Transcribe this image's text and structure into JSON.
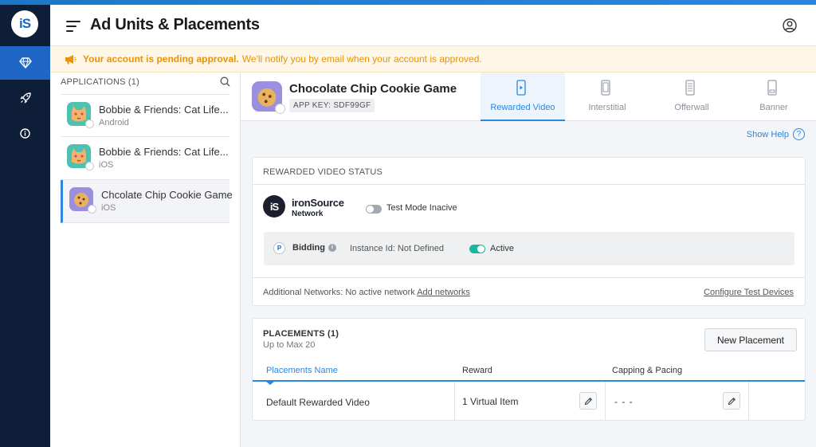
{
  "header": {
    "title": "Ad Units & Placements"
  },
  "sidebar": {
    "logo_text": "iS",
    "items": [
      {
        "name": "diamond-icon",
        "active": true
      },
      {
        "name": "rocket-icon",
        "active": false
      },
      {
        "name": "info-icon",
        "active": false
      }
    ]
  },
  "banner": {
    "strong_text": "Your account is pending approval.",
    "normal_text": "We'll notify you by email when your account is approved."
  },
  "apps": {
    "header": "APPLICATIONS (1)",
    "items": [
      {
        "name": "Bobbie & Friends: Cat Life...",
        "os": "Android",
        "icon": "cat-app-icon"
      },
      {
        "name": "Bobbie & Friends: Cat Life...",
        "os": "iOS",
        "icon": "cat-app-icon"
      },
      {
        "name": "Chcolate Chip Cookie Game",
        "os": "iOS",
        "icon": "cookie-app-icon",
        "selected": true
      }
    ]
  },
  "app_header": {
    "name": "Chocolate Chip Cookie Game",
    "app_key": "APP KEY: SDF99GF"
  },
  "tabs": [
    {
      "label": "Rewarded Video",
      "active": true
    },
    {
      "label": "Interstitial",
      "active": false
    },
    {
      "label": "Offerwall",
      "active": false
    },
    {
      "label": "Banner",
      "active": false
    }
  ],
  "help": {
    "label": "Show Help",
    "icon_text": "?"
  },
  "status": {
    "title": "REWARDED VIDEO STATUS",
    "network_logo_text": "iS",
    "network_name": "ironSource",
    "network_sub": "Network",
    "test_mode_label": "Test Mode Inacive",
    "bidding_label": "Bidding",
    "bidding_icon_text": "P",
    "info_text": "i",
    "instance_text": "Instance Id: Not Defined",
    "active_label": "Active",
    "additional_text": "Additional Networks: No active network",
    "add_networks_link": "Add networks",
    "configure_link": "Configure Test Devices"
  },
  "placements": {
    "title": "PLACEMENTS (1)",
    "subtitle": "Up to Max 20",
    "new_button": "New Placement",
    "columns": [
      "Placements Name",
      "Reward",
      "Capping & Pacing"
    ],
    "rows": [
      {
        "name": "Default Rewarded Video",
        "reward": "1 Virtual Item",
        "capping": "- - -"
      }
    ]
  },
  "colors": {
    "sidebar_bg": "#0f1e38",
    "accent": "#2b86e0",
    "warning": "#e8940a",
    "toggle_on": "#18b8a0"
  }
}
